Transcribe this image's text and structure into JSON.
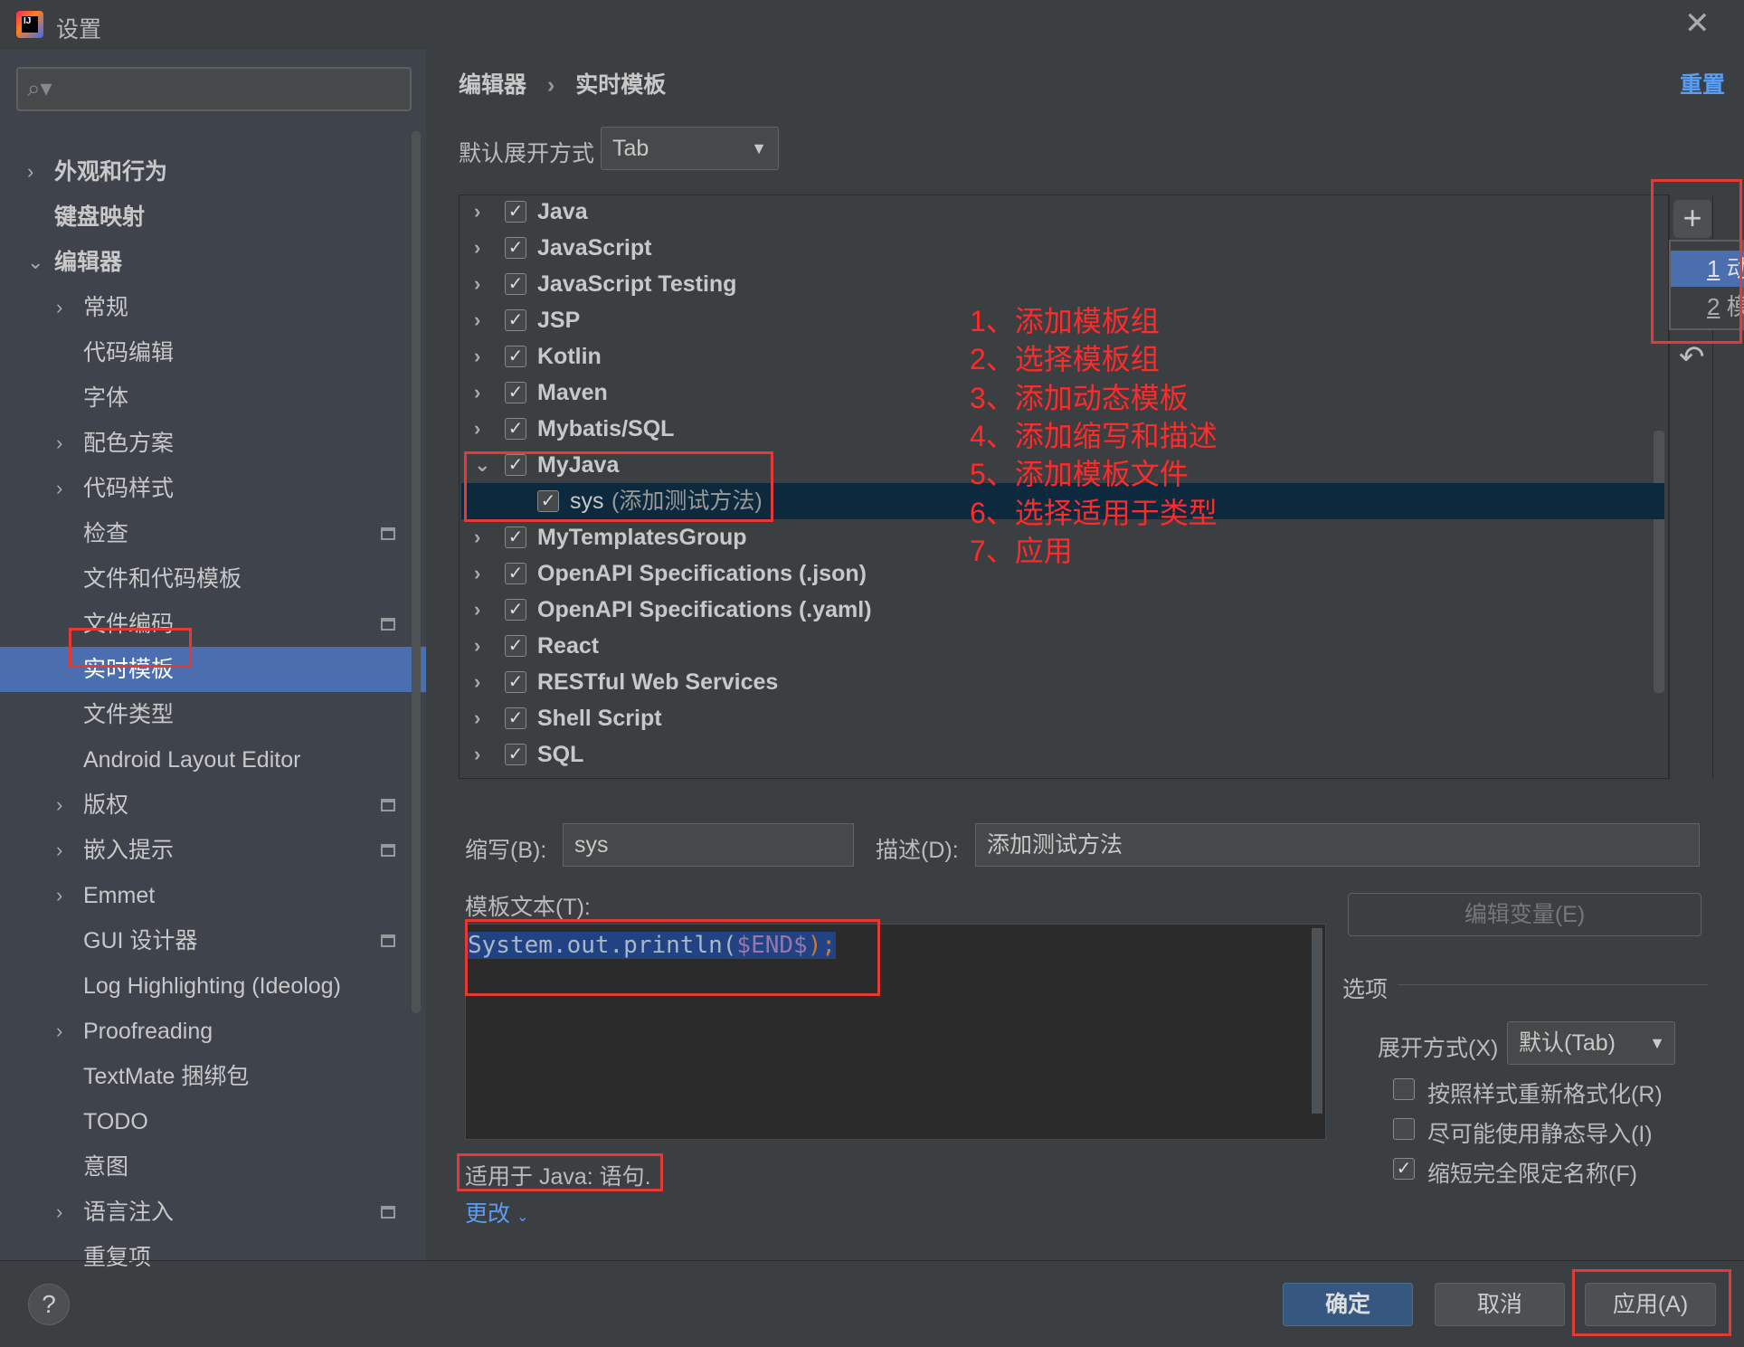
{
  "window": {
    "title": "设置",
    "close_icon": "close-icon",
    "app_icon": "intellij-icon"
  },
  "sidebar": {
    "search_placeholder": "",
    "items": [
      {
        "label": "外观和行为",
        "level": 0,
        "arrow": "›",
        "bold": true
      },
      {
        "label": "键盘映射",
        "level": 0,
        "arrow": "",
        "bold": true
      },
      {
        "label": "编辑器",
        "level": 0,
        "arrow": "⌄",
        "bold": true
      },
      {
        "label": "常规",
        "level": 1,
        "arrow": "›"
      },
      {
        "label": "代码编辑",
        "level": 1,
        "arrow": ""
      },
      {
        "label": "字体",
        "level": 1,
        "arrow": ""
      },
      {
        "label": "配色方案",
        "level": 1,
        "arrow": "›"
      },
      {
        "label": "代码样式",
        "level": 1,
        "arrow": "›"
      },
      {
        "label": "检查",
        "level": 1,
        "arrow": "",
        "badge": true
      },
      {
        "label": "文件和代码模板",
        "level": 1,
        "arrow": ""
      },
      {
        "label": "文件编码",
        "level": 1,
        "arrow": "",
        "badge": true
      },
      {
        "label": "实时模板",
        "level": 1,
        "arrow": "",
        "selected": true
      },
      {
        "label": "文件类型",
        "level": 1,
        "arrow": ""
      },
      {
        "label": "Android Layout Editor",
        "level": 1,
        "arrow": ""
      },
      {
        "label": "版权",
        "level": 1,
        "arrow": "›",
        "badge": true
      },
      {
        "label": "嵌入提示",
        "level": 1,
        "arrow": "›",
        "badge": true
      },
      {
        "label": "Emmet",
        "level": 1,
        "arrow": "›"
      },
      {
        "label": "GUI 设计器",
        "level": 1,
        "arrow": "",
        "badge": true
      },
      {
        "label": "Log Highlighting (Ideolog)",
        "level": 1,
        "arrow": ""
      },
      {
        "label": "Proofreading",
        "level": 1,
        "arrow": "›"
      },
      {
        "label": "TextMate 捆绑包",
        "level": 1,
        "arrow": ""
      },
      {
        "label": "TODO",
        "level": 1,
        "arrow": ""
      },
      {
        "label": "意图",
        "level": 1,
        "arrow": ""
      },
      {
        "label": "语言注入",
        "level": 1,
        "arrow": "›",
        "badge": true
      },
      {
        "label": "重复项",
        "level": 1,
        "arrow": ""
      }
    ]
  },
  "breadcrumb": {
    "parent": "编辑器",
    "sep": "›",
    "current": "实时模板",
    "reset": "重置"
  },
  "expand": {
    "label": "默认展开方式",
    "value": "Tab"
  },
  "tree": [
    {
      "label": "Java",
      "checked": true
    },
    {
      "label": "JavaScript",
      "checked": true
    },
    {
      "label": "JavaScript Testing",
      "checked": true
    },
    {
      "label": "JSP",
      "checked": true
    },
    {
      "label": "Kotlin",
      "checked": true
    },
    {
      "label": "Maven",
      "checked": true
    },
    {
      "label": "Mybatis/SQL",
      "checked": true
    },
    {
      "label": "MyJava",
      "checked": true,
      "expanded": true
    },
    {
      "label": "sys",
      "desc": "(添加测试方法)",
      "checked": true,
      "child": true,
      "selected": true
    },
    {
      "label": "MyTemplatesGroup",
      "checked": true
    },
    {
      "label": "OpenAPI Specifications (.json)",
      "checked": true
    },
    {
      "label": "OpenAPI Specifications (.yaml)",
      "checked": true
    },
    {
      "label": "React",
      "checked": true
    },
    {
      "label": "RESTful Web Services",
      "checked": true
    },
    {
      "label": "Shell Script",
      "checked": true
    },
    {
      "label": "SQL",
      "checked": true
    }
  ],
  "toolbar": {
    "add": "+",
    "popup": [
      "1",
      "2"
    ],
    "popup_trunc": [
      "动",
      "模"
    ],
    "undo": "↶"
  },
  "annotations": [
    "1、添加模板组",
    "2、选择模板组",
    "3、添加动态模板",
    "4、添加缩写和描述",
    "5、添加模板文件",
    "6、选择适用于类型",
    "7、应用"
  ],
  "editor": {
    "abbr_label": "缩写(B):",
    "abbr": "sys",
    "desc_label": "描述(D):",
    "desc": "添加测试方法",
    "text_label": "模板文本(T):",
    "text_plain": "System.out.println(",
    "text_var": "$END$",
    "text_end": ");",
    "edit_vars": "编辑变量(E)",
    "applies": "适用于 Java: 语句.",
    "change": "更改"
  },
  "options": {
    "title": "选项",
    "expand_label": "展开方式(X)",
    "expand_value": "默认(Tab)",
    "checks": [
      {
        "label": "按照样式重新格式化(R)",
        "checked": false
      },
      {
        "label": "尽可能使用静态导入(I)",
        "checked": false
      },
      {
        "label": "缩短完全限定名称(F)",
        "checked": true
      }
    ]
  },
  "footer": {
    "help": "?",
    "ok": "确定",
    "cancel": "取消",
    "apply": "应用(A)"
  },
  "colors": {
    "accent": "#4b6eaf",
    "annotation": "#ff2a2a",
    "link": "#589df6"
  }
}
